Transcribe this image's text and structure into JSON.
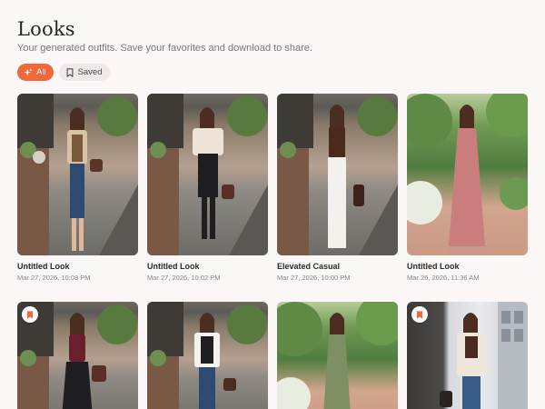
{
  "header": {
    "title": "Looks",
    "subtitle": "Your generated outfits. Save your favorites and download to share."
  },
  "filters": {
    "all_label": "All",
    "saved_label": "Saved",
    "accent_color": "#ec6a3c"
  },
  "looks": [
    {
      "title": "Untitled Look",
      "date": "Mar 27, 2026, 10:08 PM"
    },
    {
      "title": "Untitled Look",
      "date": "Mar 27, 2026, 10:02 PM"
    },
    {
      "title": "Elevated Casual",
      "date": "Mar 27, 2026, 10:00 PM"
    },
    {
      "title": "Untitled Look",
      "date": "Mar 26, 2026, 11:36 AM"
    }
  ],
  "icons": {
    "all": "sparkles-icon",
    "saved": "bookmark-icon",
    "saved_badge": "bookmark-filled-icon"
  }
}
